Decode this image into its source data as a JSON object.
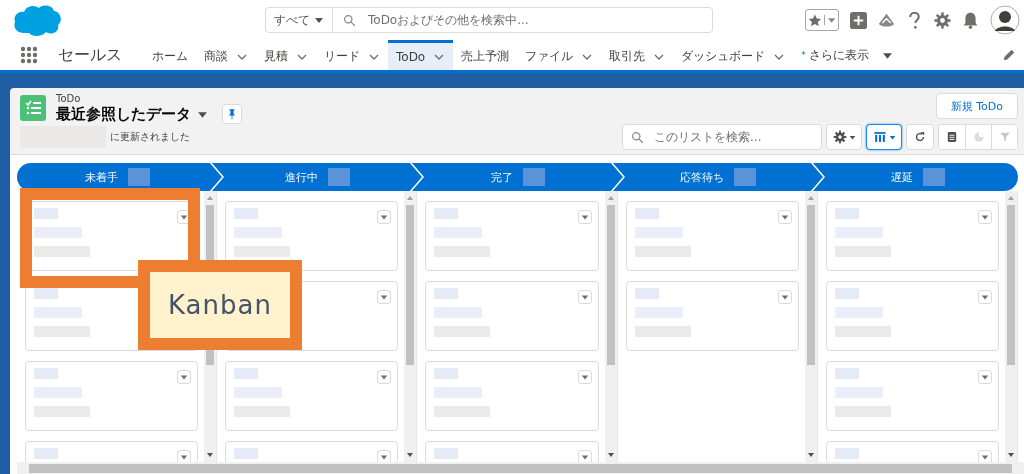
{
  "header": {
    "search_scope": "すべて",
    "search_placeholder": "ToDoおよびその他を検索中..."
  },
  "nav": {
    "app_name": "セールス",
    "items": [
      {
        "label": "ホーム",
        "has_menu": false,
        "selected": false
      },
      {
        "label": "商談",
        "has_menu": true,
        "selected": false
      },
      {
        "label": "見積",
        "has_menu": true,
        "selected": false
      },
      {
        "label": "リード",
        "has_menu": true,
        "selected": false
      },
      {
        "label": "ToDo",
        "has_menu": true,
        "selected": true
      },
      {
        "label": "売上予測",
        "has_menu": false,
        "selected": false
      },
      {
        "label": "ファイル",
        "has_menu": true,
        "selected": false
      },
      {
        "label": "取引先",
        "has_menu": true,
        "selected": false
      },
      {
        "label": "ダッシュボード",
        "has_menu": true,
        "selected": false
      }
    ],
    "more_marker": "*",
    "more": "さらに表示"
  },
  "list_header": {
    "object": "ToDo",
    "title": "最近参照したデータ",
    "updated": "に更新されました",
    "new_button": "新規 ToDo",
    "search_placeholder": "このリストを検索..."
  },
  "columns": [
    {
      "title": "未着手",
      "cards": [
        {
          "kind": "task"
        },
        {
          "kind": "task"
        },
        {
          "kind": "task"
        },
        {
          "kind": "task"
        }
      ]
    },
    {
      "title": "進行中",
      "cards": [
        {
          "kind": "task"
        },
        {
          "kind": "task"
        },
        {
          "kind": "task"
        },
        {
          "kind": "task"
        }
      ]
    },
    {
      "title": "完了",
      "cards": [
        {
          "kind": "task"
        },
        {
          "kind": "task"
        },
        {
          "kind": "task"
        },
        {
          "kind": "task"
        }
      ]
    },
    {
      "title": "応答待ち",
      "cards": [
        {
          "kind": "task"
        },
        {
          "kind": "task"
        }
      ]
    },
    {
      "title": "遅延",
      "cards": [
        {
          "kind": "task"
        },
        {
          "kind": "task"
        },
        {
          "kind": "task"
        },
        {
          "kind": "task"
        }
      ]
    }
  ],
  "annotation": {
    "label": "Kanban"
  }
}
